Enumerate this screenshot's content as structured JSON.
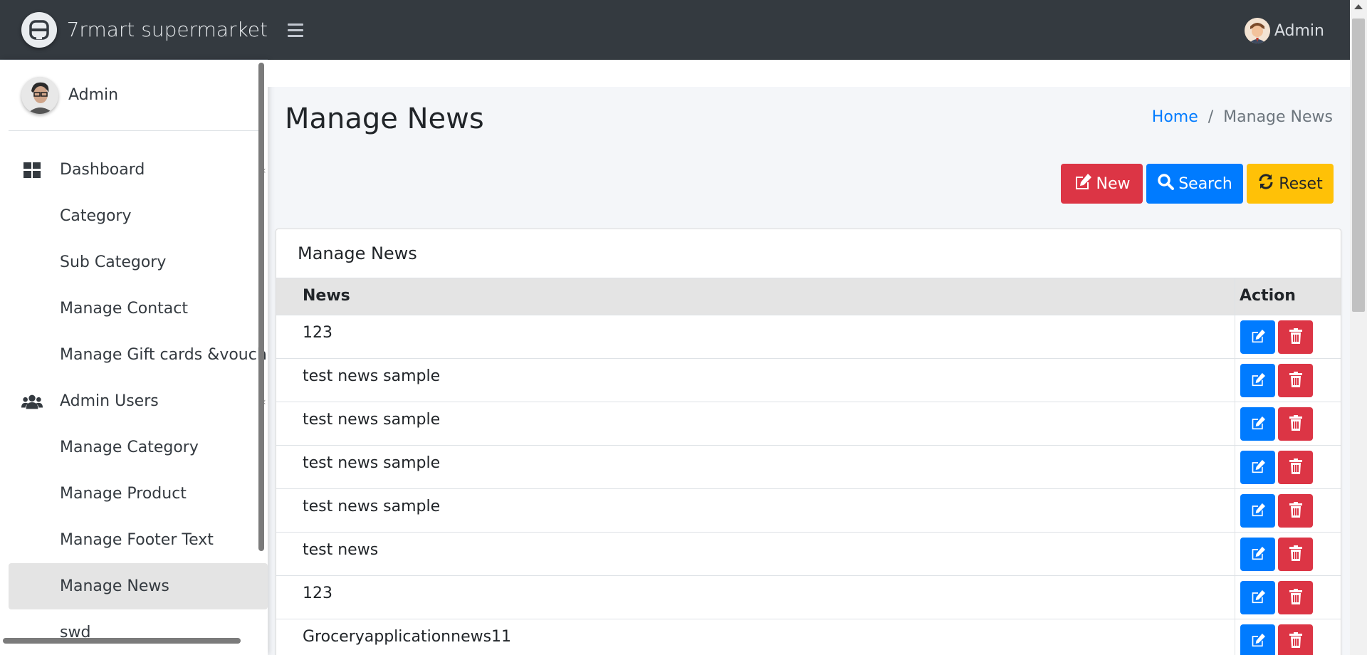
{
  "brand": {
    "name": "7rmart supermarket"
  },
  "header": {
    "user_label": "Admin"
  },
  "sidebar": {
    "user_name": "Admin",
    "items": [
      {
        "label": "Dashboard",
        "icon": "grid-icon",
        "type": "parent"
      },
      {
        "label": "Category",
        "type": "sub"
      },
      {
        "label": "Sub Category",
        "type": "sub"
      },
      {
        "label": "Manage Contact",
        "type": "sub"
      },
      {
        "label": "Manage Gift cards &voucher",
        "type": "sub"
      },
      {
        "label": "Admin Users",
        "icon": "users-icon",
        "type": "parent"
      },
      {
        "label": "Manage Category",
        "type": "sub"
      },
      {
        "label": "Manage Product",
        "type": "sub"
      },
      {
        "label": "Manage Footer Text",
        "type": "sub"
      },
      {
        "label": "Manage News",
        "type": "sub",
        "active": true
      },
      {
        "label": "swd",
        "type": "sub"
      }
    ]
  },
  "page": {
    "title": "Manage News",
    "breadcrumb": {
      "home": "Home",
      "separator": "/",
      "current": "Manage News"
    }
  },
  "toolbar": {
    "new_label": "New",
    "search_label": "Search",
    "reset_label": "Reset"
  },
  "card": {
    "title": "Manage News",
    "columns": [
      "News",
      "Action"
    ],
    "rows": [
      "123",
      "test news sample",
      "test news sample",
      "test news sample",
      "test news sample",
      "test news",
      "123",
      "Groceryapplicationnews11"
    ]
  },
  "colors": {
    "primary": "#007bff",
    "danger": "#dc3545",
    "warning": "#ffc107",
    "topbar": "#343a40"
  }
}
